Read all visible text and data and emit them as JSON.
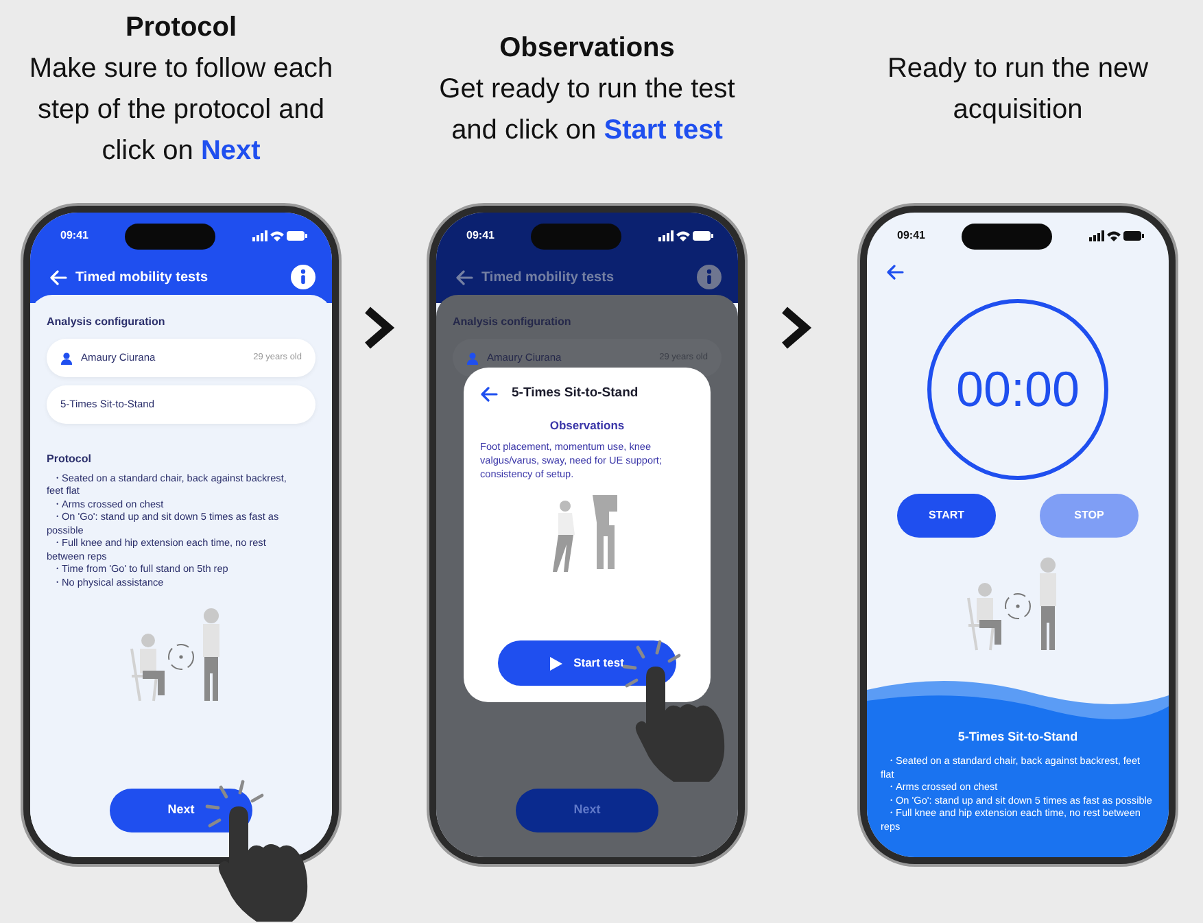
{
  "panels": [
    {
      "kind": "protocol",
      "heading": "Protocol",
      "caption": "Make sure to follow each step of the protocol and click on **Next**",
      "screen": {
        "time": "09:41",
        "dimmed": false,
        "title": "Timed mobility tests",
        "section": "Analysis configuration",
        "patient": {
          "name": "Amaury Ciurana",
          "age": "29 years old"
        },
        "test": "5-Times Sit-to-Stand",
        "protocol_title": "Protocol",
        "protocol": [
          "・Seated on a standard chair, back against backrest, feet flat",
          "・Arms crossed on chest",
          "・On 'Go': stand up and sit down 5 times as fast as possible",
          "・Full knee and hip extension each time, no rest between reps",
          "・Time from 'Go' to full stand on 5th rep",
          "・No physical assistance"
        ],
        "button": "Next"
      }
    },
    {
      "kind": "protocol",
      "heading": "Observations",
      "caption": "Get ready to run the test and click on **Start test**",
      "screen": {
        "time": "09:41",
        "dimmed": true,
        "title": "Timed mobility tests",
        "section": "Analysis configuration",
        "patient": {
          "name": "Amaury Ciurana",
          "age": "29 years old"
        },
        "button": "Next",
        "modal": {
          "title": "5-Times Sit-to-Stand",
          "subtitle": "Observations",
          "text": "Foot placement, momentum use, knee valgus/varus, sway, need for UE support; consistency of setup.",
          "button": "Start test"
        }
      }
    },
    {
      "kind": "timer",
      "caption": "Ready to run the new acquisition",
      "screen": {
        "time": "09:41",
        "timer": "00:00",
        "buttons": [
          {
            "label": "START",
            "disabled": false
          },
          {
            "label": "STOP",
            "disabled": true
          }
        ],
        "panel_title": "5-Times Sit-to-Stand",
        "protocol": [
          "・Seated on a standard chair, back against backrest, feet flat",
          "・Arms crossed on chest",
          "・On 'Go': stand up and sit down 5 times as fast as possible",
          "・Full knee and hip extension each time, no rest between reps"
        ]
      }
    }
  ]
}
